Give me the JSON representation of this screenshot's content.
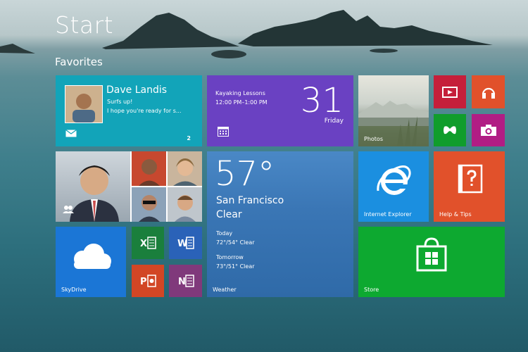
{
  "header": {
    "title": "Start",
    "group": "Favorites"
  },
  "tiles": {
    "mail": {
      "sender": "Dave Landis",
      "subject": "Surfs up!",
      "preview": "I hope you're ready for s...",
      "count": "2"
    },
    "calendar": {
      "event_title": "Kayaking Lessons",
      "event_time": "12:00 PM–1:00 PM",
      "day": "31",
      "weekday": "Friday"
    },
    "photos": {
      "label": "Photos"
    },
    "weather": {
      "temp": "57°",
      "city": "San Francisco",
      "condition": "Clear",
      "today_label": "Today",
      "today_value": "72°/54° Clear",
      "tomorrow_label": "Tomorrow",
      "tomorrow_value": "73°/51° Clear",
      "label": "Weather"
    },
    "ie": {
      "label": "Internet Explorer"
    },
    "help": {
      "label": "Help & Tips"
    },
    "skydrive": {
      "label": "SkyDrive"
    },
    "store": {
      "label": "Store"
    }
  },
  "colors": {
    "mail": "#12a4b9",
    "calendar": "#6a41c2",
    "weather": "#3a76b5",
    "video": "#c51f3a",
    "music": "#e1512b",
    "games": "#109d2c",
    "camera": "#b11d84",
    "ie": "#1b8fe0",
    "help": "#e1512b",
    "skydrive": "#1b76d6",
    "store": "#0da930"
  }
}
